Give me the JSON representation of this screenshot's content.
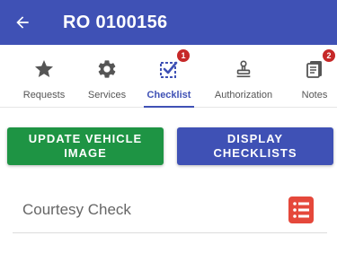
{
  "appbar": {
    "title": "RO 0100156",
    "back_icon": "arrow-left-icon"
  },
  "tabs": [
    {
      "label": "Requests",
      "icon": "star-icon",
      "badge": ""
    },
    {
      "label": "Services",
      "icon": "gear-icon",
      "badge": ""
    },
    {
      "label": "Checklist",
      "icon": "checkbox-checked-icon",
      "badge": "1",
      "active": true
    },
    {
      "label": "Authorization",
      "icon": "stamp-icon",
      "badge": ""
    },
    {
      "label": "Notes",
      "icon": "notes-icon",
      "badge": "2"
    }
  ],
  "buttons": {
    "update_vehicle_image": "UPDATE VEHICLE IMAGE",
    "display_checklists": "DISPLAY CHECKLISTS"
  },
  "checklist_items": [
    {
      "label": "Courtesy Check",
      "icon": "checklist-document-icon"
    }
  ],
  "colors": {
    "primary": "#3f51b5",
    "green": "#1e9444",
    "badge": "#c62828",
    "checklist_icon": "#e5483b"
  }
}
